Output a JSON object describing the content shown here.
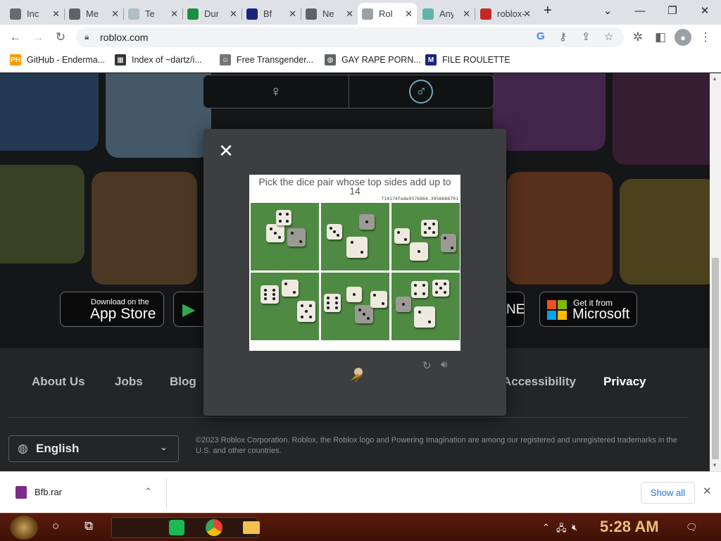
{
  "tabs": [
    {
      "label": "Inc",
      "fav_color": "#6a6a6a"
    },
    {
      "label": "Me",
      "fav_color": "#5f6368"
    },
    {
      "label": "Te",
      "fav_color": "#b0bec5"
    },
    {
      "label": "Dur",
      "fav_color": "#1e8e3e"
    },
    {
      "label": "Bf",
      "fav_color": "#1a237e"
    },
    {
      "label": "Ne",
      "fav_color": "#5f6368"
    },
    {
      "label": "Rol",
      "fav_color": "#9aa0a6"
    },
    {
      "label": "Any",
      "fav_color": "#5fb4a9"
    },
    {
      "label": "roblox-",
      "fav_color": "#c62828"
    }
  ],
  "address": {
    "url": "roblox.com"
  },
  "bookmarks": [
    {
      "label": "GitHub - Enderma...",
      "fav_text": "PH",
      "fav_color": "#ff9800"
    },
    {
      "label": "Index of ~dartz/i...",
      "fav_text": "▦",
      "fav_color": "#333333"
    },
    {
      "label": "Free Transgender...",
      "fav_text": "☺",
      "fav_color": "#757575"
    },
    {
      "label": "GAY RAPE PORN...",
      "fav_text": "◍",
      "fav_color": "#5f6368"
    },
    {
      "label": "FILE ROULETTE",
      "fav_text": "M",
      "fav_color": "#1a237e"
    }
  ],
  "page": {
    "stores": [
      {
        "small": "Download on the",
        "big": "App Store"
      },
      {
        "small": "Get it from",
        "big": "Microsoft"
      }
    ],
    "footer_links": [
      "About Us",
      "Jobs",
      "Blog",
      "Accessibility",
      "Privacy"
    ],
    "language": "English",
    "copyright": "©2023 Roblox Corporation. Roblox, the Roblox logo and Powering Imagination are among our registered and unregistered trademarks in the U.S. and other countries."
  },
  "captcha": {
    "prompt": "Pick the dice pair whose top sides add up to 14",
    "token": "714174fede9576864.3956686701"
  },
  "downloads": {
    "file": "Bfb.rar",
    "show_all": "Show all"
  },
  "taskbar": {
    "time": "5:28 AM"
  }
}
